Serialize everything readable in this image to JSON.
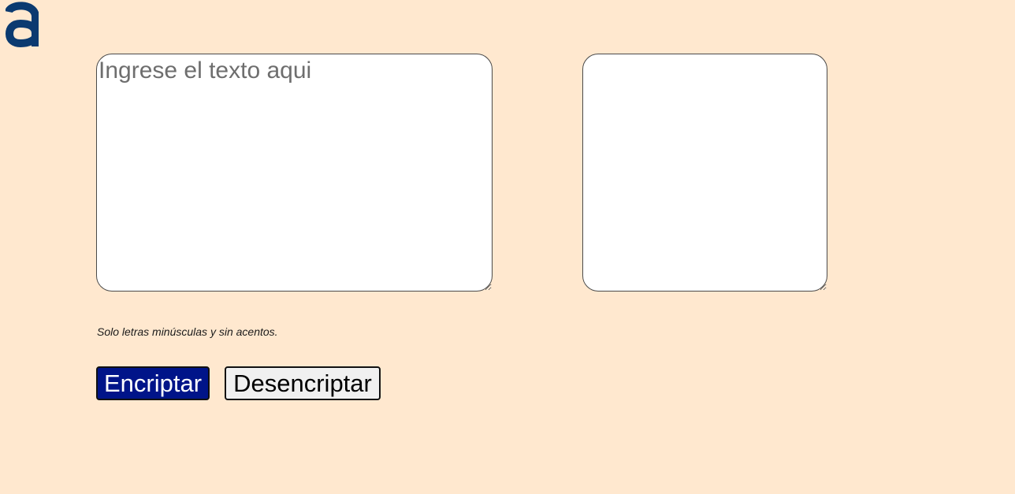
{
  "logo": {
    "icon": "letter-a-logo-icon",
    "color": "#0b3a70"
  },
  "input": {
    "placeholder": "Ingrese el texto aqui",
    "value": ""
  },
  "output": {
    "value": ""
  },
  "hint": "Solo letras minúsculas y sin acentos.",
  "buttons": {
    "encrypt_label": "Encriptar",
    "decrypt_label": "Desencriptar"
  },
  "colors": {
    "background": "#ffe8cf",
    "encrypt_button": "#001489",
    "decrypt_button": "#f0f0f0"
  }
}
